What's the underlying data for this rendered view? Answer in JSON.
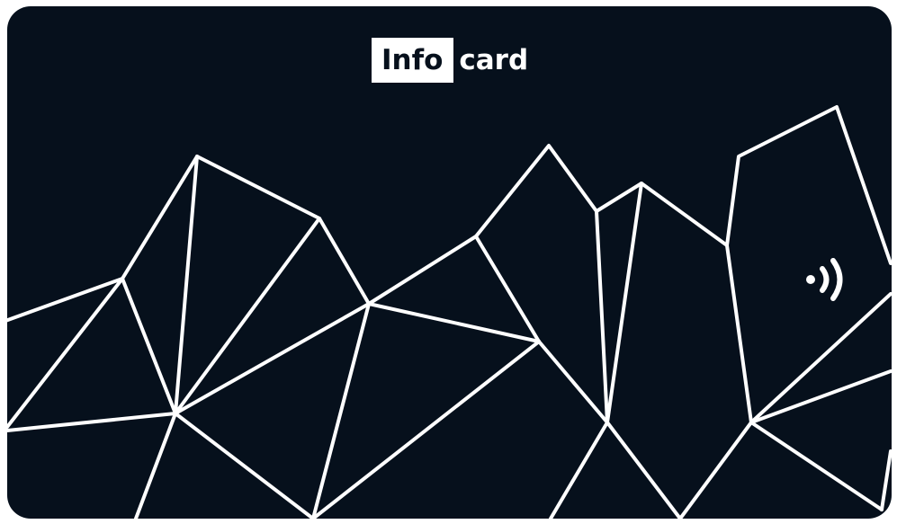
{
  "card": {
    "brand_box_text": "Info",
    "brand_rest_text": "card",
    "colors": {
      "background": "#06101c",
      "lines": "#ffffff",
      "logo_box": "#ffffff"
    },
    "contactless_icon": "contactless-icon"
  }
}
